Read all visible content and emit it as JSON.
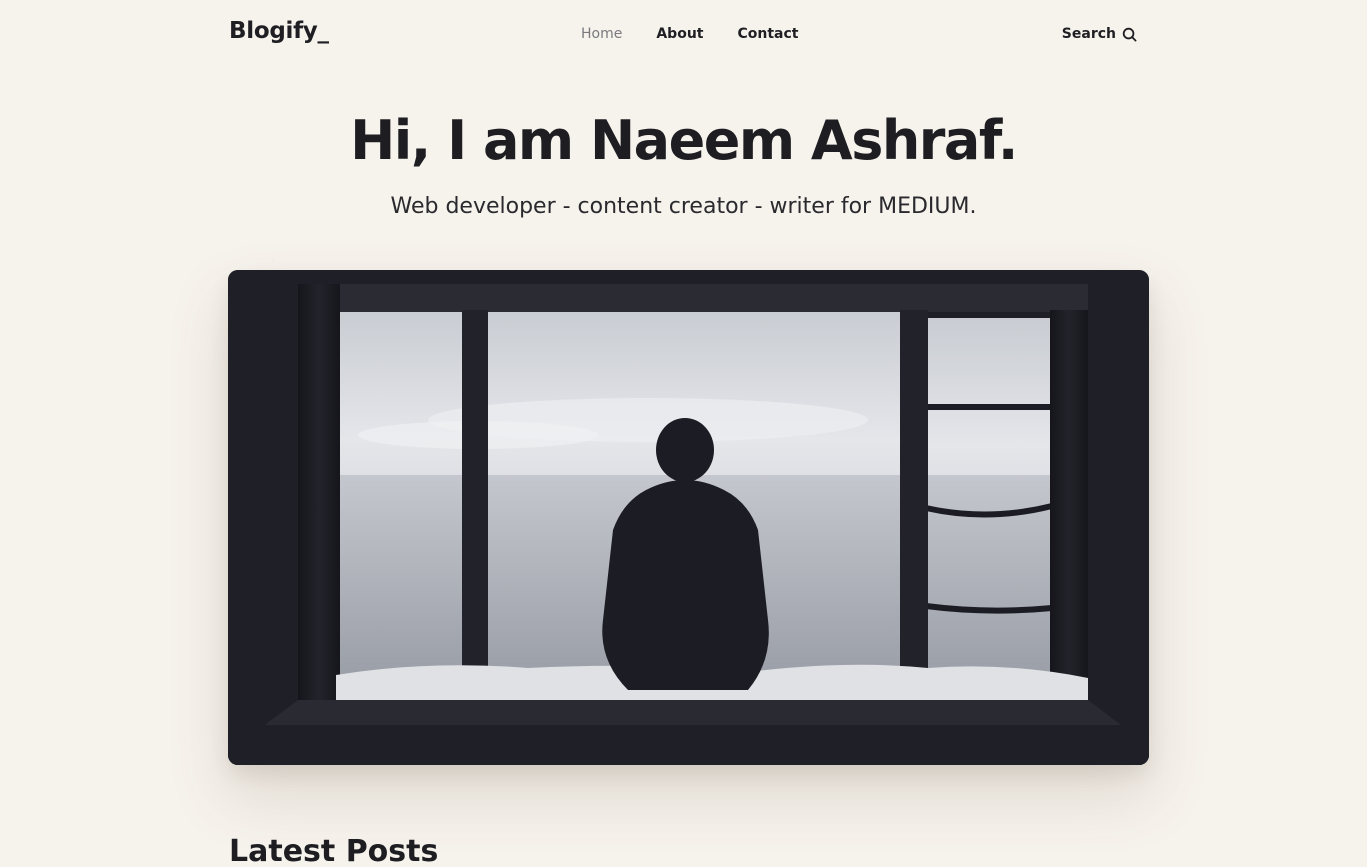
{
  "header": {
    "logo": "Blogify_",
    "nav": [
      {
        "label": "Home",
        "active": true
      },
      {
        "label": "About",
        "active": false
      },
      {
        "label": "Contact",
        "active": false
      }
    ],
    "search_label": "Search",
    "search_icon": "search-icon"
  },
  "hero": {
    "title": "Hi, I am Naeem Ashraf.",
    "subtitle": "Web developer - content creator - writer for MEDIUM."
  },
  "main": {
    "latest_posts_title": "Latest Posts"
  },
  "colors": {
    "background": "#f6f2ec",
    "text": "#1e1e22",
    "nav_active": "#7a7a7e",
    "image_dark": "#1f1f27"
  }
}
